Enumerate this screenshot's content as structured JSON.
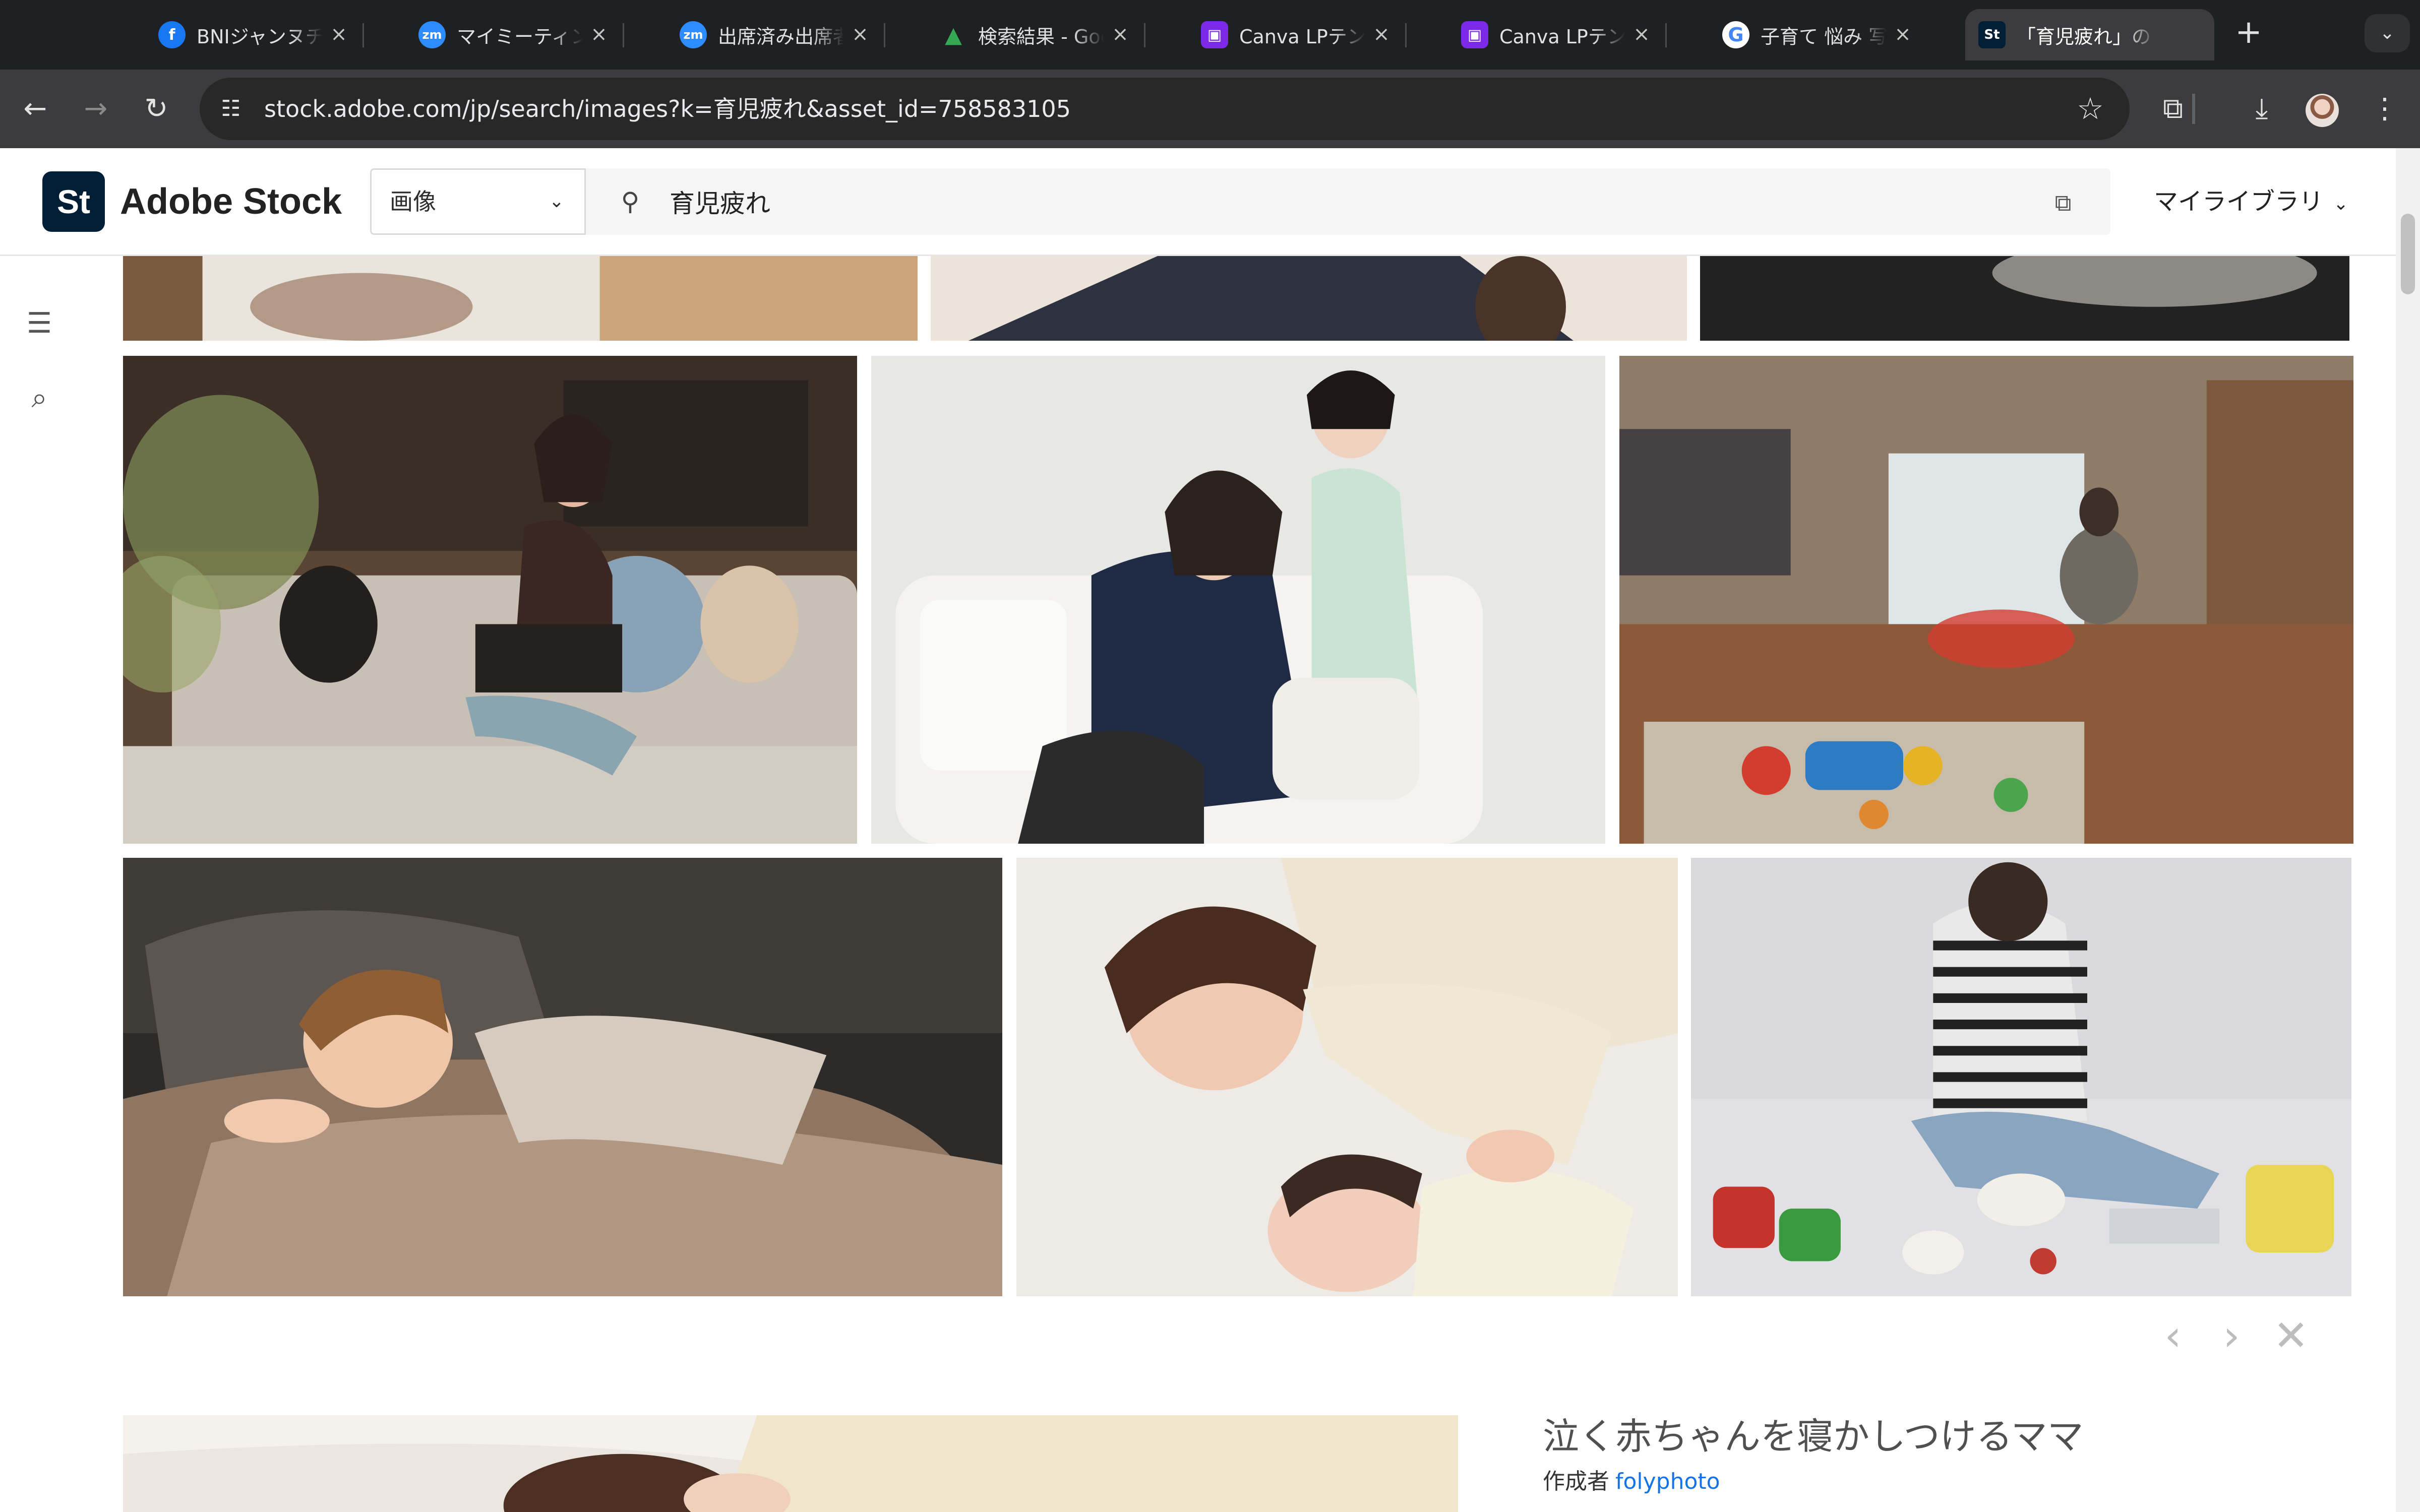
{
  "browser": {
    "tabs": [
      {
        "title": "BNIジャンヌチャ",
        "icon": "facebook-icon",
        "color": "#1877f2",
        "glyph": "f"
      },
      {
        "title": "マイミーティング",
        "icon": "zoom-icon",
        "color": "#2d8cff",
        "glyph": "zm"
      },
      {
        "title": "出席済み出席者",
        "icon": "zoom-icon",
        "color": "#2d8cff",
        "glyph": "zm"
      },
      {
        "title": "検索結果 - Goog",
        "icon": "google-drive-icon",
        "color": "#34a853",
        "glyph": "▲"
      },
      {
        "title": "Canva LPテンプ",
        "icon": "canva-icon",
        "color": "#7d2ae8",
        "glyph": "▣"
      },
      {
        "title": "Canva LPテンプ",
        "icon": "canva-icon",
        "color": "#7d2ae8",
        "glyph": "▣"
      },
      {
        "title": "子育て 悩み 写真",
        "icon": "google-icon",
        "color": "#4285f4",
        "glyph": "G"
      },
      {
        "title": "「育児疲れ」の",
        "icon": "adobe-stock-icon",
        "color": "#001e36",
        "glyph": "St",
        "active": true
      }
    ],
    "new_tab": "+",
    "url": "stock.adobe.com/jp/search/images?k=育児疲れ&asset_id=758583105"
  },
  "stock": {
    "logo_mark": "St",
    "logo_text": "Adobe Stock",
    "type_select": "画像",
    "search_query": "育児疲れ",
    "library_label": "マイライブラリ"
  },
  "detail": {
    "title": "泣く赤ちゃんを寝かしつけるママ",
    "author_label": "作成者",
    "author_name": "folyphoto"
  },
  "colors": {
    "chrome_dark": "#1f2022",
    "chrome_toolbar": "#3c3c3f",
    "adobe_navy": "#001e36",
    "link_blue": "#1473e6"
  }
}
